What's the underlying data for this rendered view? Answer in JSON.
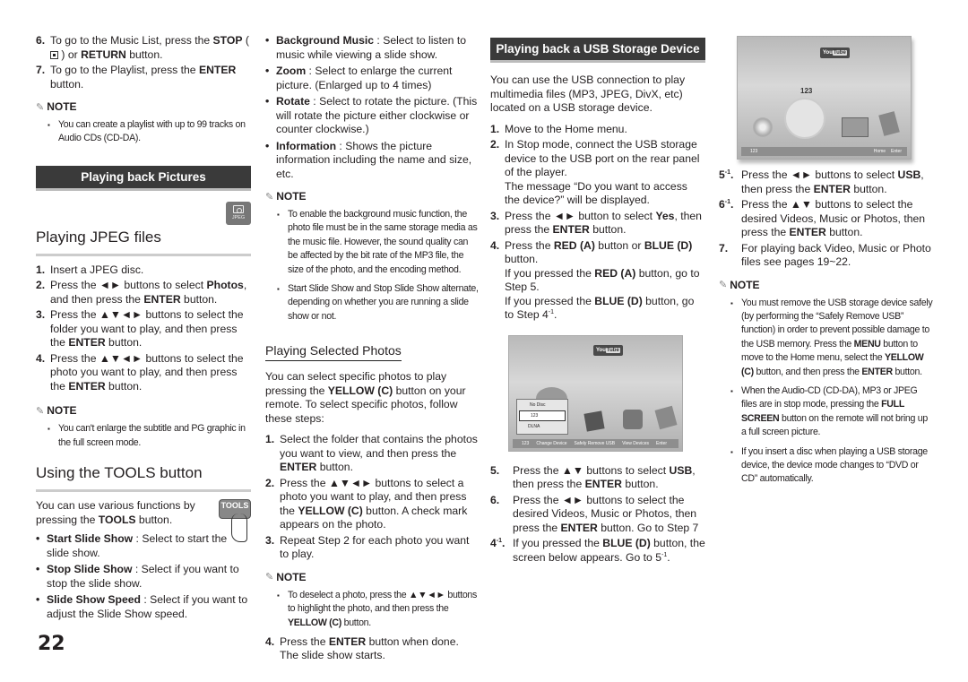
{
  "page_number": "22",
  "col1": {
    "steps_top": [
      {
        "num": "6.",
        "html": "To go to the Music List, press the <b>STOP</b> ( <span style=\"display:inline-block;width:9px;height:9px;border:1px solid #333;vertical-align:-1px;position:relative\"><span style=\"position:absolute;left:2px;top:2px;width:3px;height:3px;background:#222\"></span></span> ) or <b>RETURN</b> button."
      },
      {
        "num": "7.",
        "html": "To go to the Playlist, press the <b>ENTER</b> button."
      }
    ],
    "note_title": "NOTE",
    "note1": [
      "You can create a playlist with up to 99 tracks on Audio CDs (CD-DA)."
    ],
    "section_bar": "Playing back Pictures",
    "jpeg_icon_label": "JPEG",
    "h_jpeg": "Playing JPEG files",
    "jpeg_steps": [
      {
        "num": "1.",
        "html": "Insert a JPEG disc."
      },
      {
        "num": "2.",
        "html": "Press the ◄► buttons to select <b>Photos</b>, and then press the <b>ENTER</b> button."
      },
      {
        "num": "3.",
        "html": "Press the ▲▼◄► buttons to select the folder you want to play, and then press the <b>ENTER</b> button."
      },
      {
        "num": "4.",
        "html": "Press the ▲▼◄► buttons to select the photo you want to play, and then press the <b>ENTER</b> button."
      }
    ],
    "note2": [
      "You can't enlarge the subtitle and PG graphic in the full screen mode."
    ],
    "h_tools": "Using the TOOLS button",
    "tools_intro": "You can use various functions by pressing the <b>TOOLS</b> button.",
    "tools_icon_label": "TOOLS",
    "tools_bullets": [
      {
        "html": "<b>Start Slide Show</b> : Select to start the slide show."
      },
      {
        "html": "<b>Stop Slide Show</b> : Select if you want to stop the slide show."
      },
      {
        "html": "<b>Slide Show Speed</b> : Select if you want to adjust the Slide Show speed."
      }
    ]
  },
  "col2": {
    "bullets": [
      {
        "html": "<b>Background Music</b> : Select to listen to music while viewing a slide show."
      },
      {
        "html": "<b>Zoom</b> : Select to enlarge the current picture. (Enlarged up to 4 times)"
      },
      {
        "html": "<b>Rotate</b> : Select to rotate the picture. (This will rotate the picture either clockwise or counter clockwise.)"
      },
      {
        "html": "<b>Information</b> : Shows the picture information including the name and size, etc."
      }
    ],
    "note_title": "NOTE",
    "note1": [
      "To enable the background music function, the photo file must be in the same storage media as the music file. However, the sound quality can be affected by the bit rate of the MP3 file, the size of the photo, and the encoding method.",
      "Start Slide Show and Stop Slide Show alternate, depending on whether you are running a slide show or not."
    ],
    "h_selected": "Playing Selected Photos",
    "selected_intro": "You can select specific photos to play pressing the <b>YELLOW (C)</b> button on your remote. To select specific photos, follow these steps:",
    "selected_steps": [
      {
        "num": "1.",
        "html": "Select the folder that contains the photos you want to view, and then press the <b>ENTER</b> button."
      },
      {
        "num": "2.",
        "html": "Press the ▲▼◄► buttons to select a photo you want to play, and then press the <b>YELLOW (C)</b> button. A check mark appears on the photo."
      },
      {
        "num": "3.",
        "html": "Repeat Step 2 for each photo you want to play."
      }
    ],
    "note2": [
      "To deselect a photo, press the ▲▼◄► buttons to highlight the photo, and then press the <b>YELLOW (C)</b> button."
    ],
    "selected_steps_after": [
      {
        "num": "4.",
        "html": "Press the <b>ENTER</b> button when done. The slide show starts."
      }
    ]
  },
  "col3": {
    "section_bar": "Playing back a USB Storage Device",
    "intro": "You can use the USB connection to play multimedia files (MP3, JPEG, DivX, etc) located on a USB storage device.",
    "steps": [
      {
        "num": "1.",
        "html": "Move to the Home menu."
      },
      {
        "num": "2.",
        "html": "In Stop mode, connect the USB storage device to the USB port on the rear panel of the player.<br>The message “Do you want to access the device?” will be displayed."
      },
      {
        "num": "3.",
        "html": "Press the ◄► button to select <b>Yes</b>, then press the <b>ENTER</b> button."
      },
      {
        "num": "4.",
        "html": "Press the <b>RED (A)</b> button or <b>BLUE (D)</b> button.<br>If you pressed the <b>RED (A)</b> button, go to Step 5.<br>If you pressed the <b>BLUE (D)</b> button, go to Step 4<sup>-1</sup>."
      }
    ],
    "screen": {
      "youtube_a": "You",
      "youtube_b": "Tube",
      "menu_items": [
        "No Disc",
        "123",
        "DLNA"
      ],
      "bar_items": [
        "123",
        "Change Device",
        "Safely Remove USB",
        "View Devices",
        "Enter"
      ]
    },
    "steps_after": [
      {
        "num": "5.",
        "html": "Press the ▲▼ buttons to select <b>USB</b>, then press the <b>ENTER</b> button."
      },
      {
        "num": "6.",
        "html": "Press the ◄► buttons to select the desired Videos, Music or Photos, then press the <b>ENTER</b> button. Go to Step 7"
      },
      {
        "num": "4<sup>-1</sup>.",
        "html": "If you pressed the <b>BLUE (D)</b> button, the screen below appears. Go to 5<sup>-1</sup>."
      }
    ]
  },
  "col4": {
    "screen": {
      "youtube_a": "You",
      "youtube_b": "Tube",
      "label": "123",
      "bar_left": "123",
      "bar_right": [
        "Home",
        "Enter"
      ]
    },
    "steps": [
      {
        "num": "5<sup>-1</sup>.",
        "html": "Press the ◄► buttons to select <b>USB</b>, then press the <b>ENTER</b> button."
      },
      {
        "num": "6<sup>-1</sup>.",
        "html": "Press the ▲▼ buttons to select the desired Videos, Music or Photos, then press the <b>ENTER</b> button."
      },
      {
        "num": "7.",
        "html": "For playing back Video, Music or Photo files see pages 19~22."
      }
    ],
    "note_title": "NOTE",
    "note": [
      "You must remove the USB storage device safely (by performing the “Safely Remove USB” function) in order to prevent possible damage to the USB memory. Press the <b>MENU</b> button to move to the Home menu, select the <b>YELLOW (C)</b> button, and then press the <b>ENTER</b> button.",
      "When the Audio-CD (CD-DA), MP3 or JPEG files are in stop mode, pressing the <b>FULL SCREEN</b> button on the remote will not bring up a full screen picture.",
      "If you insert a disc when playing a USB storage device, the device mode changes to “DVD or CD” automatically."
    ]
  }
}
